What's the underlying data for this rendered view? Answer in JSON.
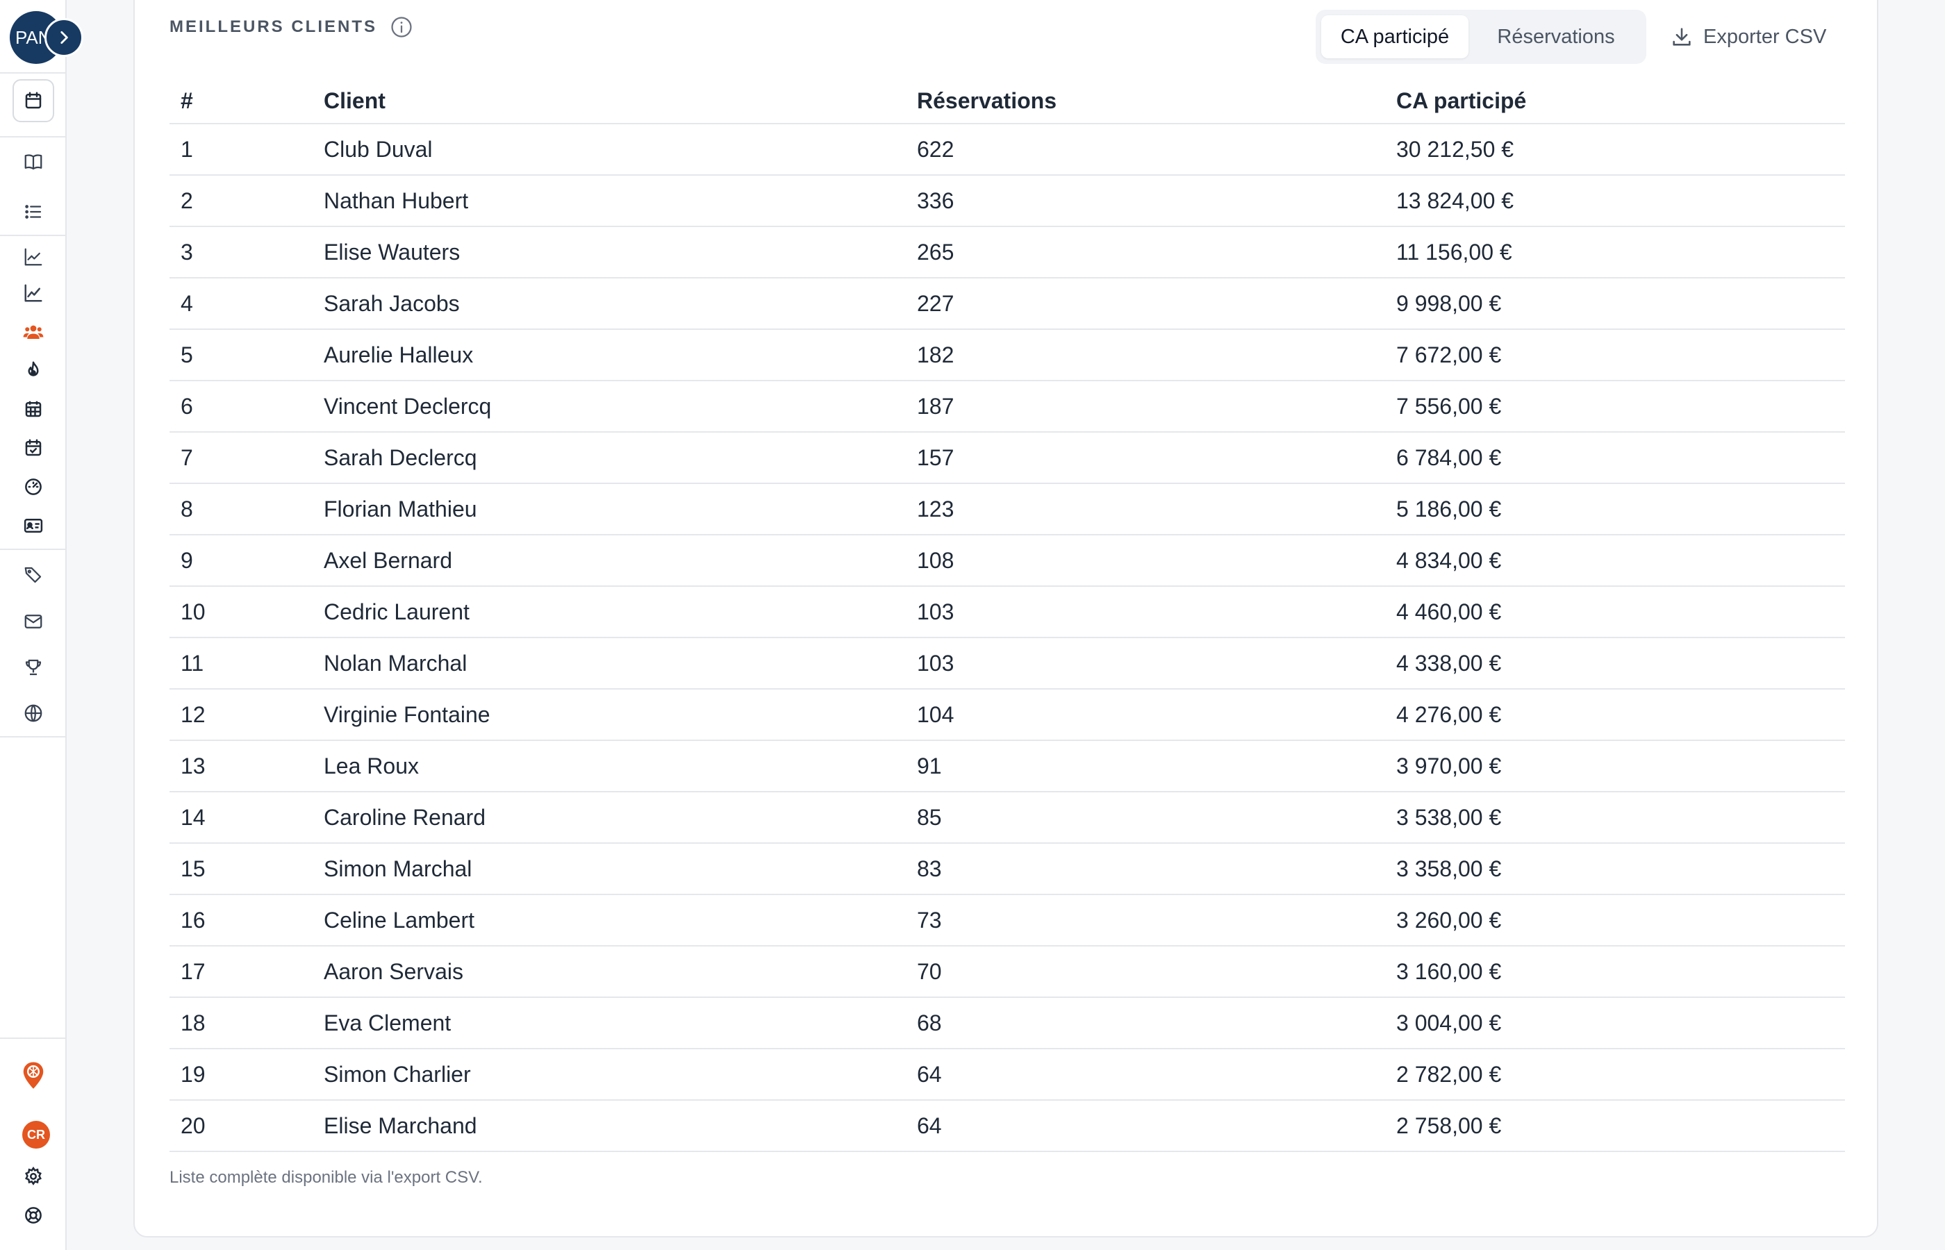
{
  "sidebar": {
    "org_initials": "PAN",
    "user_initials": "CR",
    "accent_color": "#e4551f",
    "brand_color": "#173a63",
    "icons": [
      "calendar-icon",
      "book-icon",
      "list-icon",
      "line-chart-icon",
      "trend-chart-icon",
      "users-icon",
      "fire-icon",
      "calendar-grid-icon",
      "calendar-check-icon",
      "gauge-icon",
      "id-card-icon",
      "tags-icon",
      "mail-icon",
      "trophy-icon",
      "globe-icon",
      "location-pin-icon",
      "gear-icon",
      "help-buoy-icon"
    ]
  },
  "section": {
    "title": "MEILLEURS CLIENTS",
    "toggle_active": "CA participé",
    "toggle_inactive": "Réservations",
    "export_label": "Exporter CSV"
  },
  "table": {
    "headers": [
      "#",
      "Client",
      "Réservations",
      "CA participé"
    ],
    "rows": [
      {
        "rank": "1",
        "client": "Club Duval",
        "reservations": "622",
        "ca": "30 212,50 €"
      },
      {
        "rank": "2",
        "client": "Nathan Hubert",
        "reservations": "336",
        "ca": "13 824,00 €"
      },
      {
        "rank": "3",
        "client": "Elise Wauters",
        "reservations": "265",
        "ca": "11 156,00 €"
      },
      {
        "rank": "4",
        "client": "Sarah Jacobs",
        "reservations": "227",
        "ca": "9 998,00 €"
      },
      {
        "rank": "5",
        "client": "Aurelie Halleux",
        "reservations": "182",
        "ca": "7 672,00 €"
      },
      {
        "rank": "6",
        "client": "Vincent Declercq",
        "reservations": "187",
        "ca": "7 556,00 €"
      },
      {
        "rank": "7",
        "client": "Sarah Declercq",
        "reservations": "157",
        "ca": "6 784,00 €"
      },
      {
        "rank": "8",
        "client": "Florian Mathieu",
        "reservations": "123",
        "ca": "5 186,00 €"
      },
      {
        "rank": "9",
        "client": "Axel Bernard",
        "reservations": "108",
        "ca": "4 834,00 €"
      },
      {
        "rank": "10",
        "client": "Cedric Laurent",
        "reservations": "103",
        "ca": "4 460,00 €"
      },
      {
        "rank": "11",
        "client": "Nolan Marchal",
        "reservations": "103",
        "ca": "4 338,00 €"
      },
      {
        "rank": "12",
        "client": "Virginie Fontaine",
        "reservations": "104",
        "ca": "4 276,00 €"
      },
      {
        "rank": "13",
        "client": "Lea Roux",
        "reservations": "91",
        "ca": "3 970,00 €"
      },
      {
        "rank": "14",
        "client": "Caroline Renard",
        "reservations": "85",
        "ca": "3 538,00 €"
      },
      {
        "rank": "15",
        "client": "Simon Marchal",
        "reservations": "83",
        "ca": "3 358,00 €"
      },
      {
        "rank": "16",
        "client": "Celine Lambert",
        "reservations": "73",
        "ca": "3 260,00 €"
      },
      {
        "rank": "17",
        "client": "Aaron Servais",
        "reservations": "70",
        "ca": "3 160,00 €"
      },
      {
        "rank": "18",
        "client": "Eva Clement",
        "reservations": "68",
        "ca": "3 004,00 €"
      },
      {
        "rank": "19",
        "client": "Simon Charlier",
        "reservations": "64",
        "ca": "2 782,00 €"
      },
      {
        "rank": "20",
        "client": "Elise Marchand",
        "reservations": "64",
        "ca": "2 758,00 €"
      }
    ]
  },
  "footnote": "Liste complète disponible via l'export CSV."
}
